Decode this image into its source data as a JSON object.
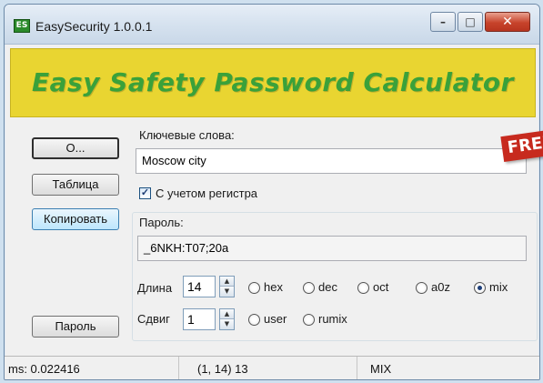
{
  "window": {
    "title": "EasySecurity 1.0.0.1"
  },
  "banner": {
    "title": "Easy Safety Password Calculator",
    "badge": "FREE"
  },
  "left_buttons": {
    "open": "O...",
    "table": "Таблица",
    "copy": "Копировать",
    "password": "Пароль"
  },
  "keywords": {
    "label": "Ключевые слова:",
    "value": "Moscow city",
    "case_sensitive_label": "С учетом регистра",
    "case_sensitive_checked": true
  },
  "password": {
    "label": "Пароль:",
    "value": "_6NKH:T07;20a"
  },
  "length": {
    "label": "Длина",
    "value": "14"
  },
  "shift": {
    "label": "Сдвиг",
    "value": "1"
  },
  "modes": [
    {
      "label": "hex",
      "checked": false
    },
    {
      "label": "dec",
      "checked": false
    },
    {
      "label": "oct",
      "checked": false
    },
    {
      "label": "a0z",
      "checked": false
    },
    {
      "label": "mix",
      "checked": true
    },
    {
      "label": "user",
      "checked": false
    },
    {
      "label": "rumix",
      "checked": false
    }
  ],
  "status": {
    "time": "ms: 0.022416",
    "position": "(1, 14) 13",
    "mode": "MIX"
  }
}
